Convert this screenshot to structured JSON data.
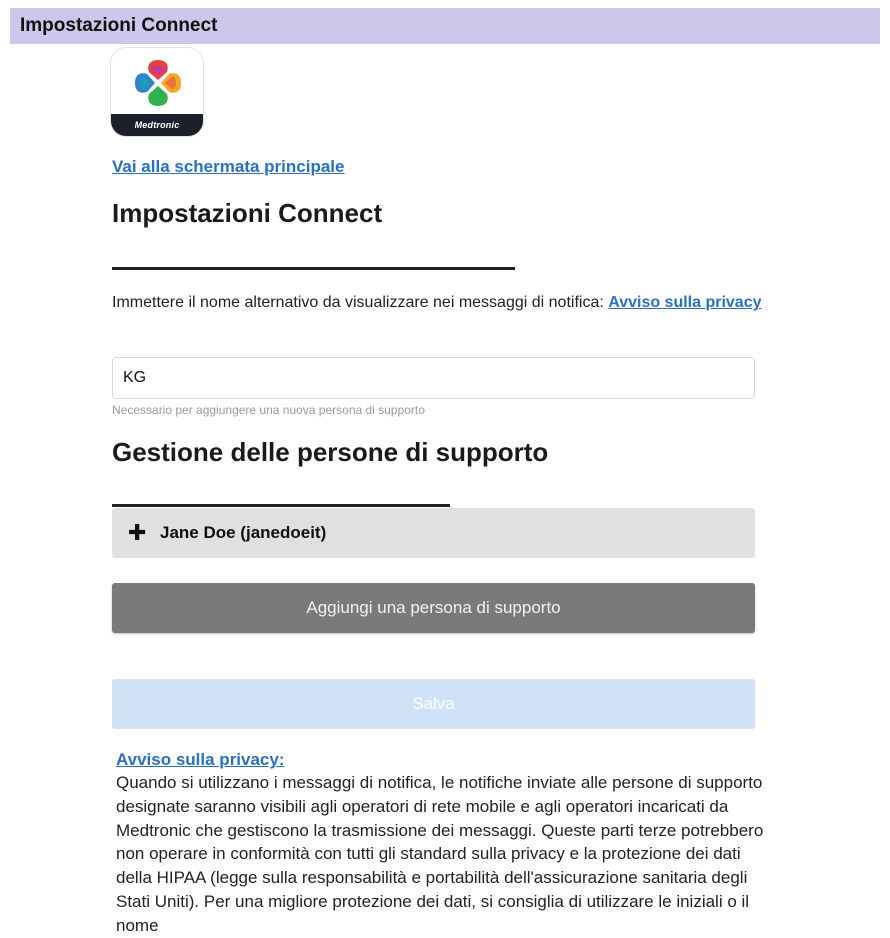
{
  "window": {
    "title": "Impostazioni Connect"
  },
  "brand": {
    "logo_text": "Medtronic"
  },
  "nav": {
    "home_link": "Vai alla schermata principale"
  },
  "settings": {
    "heading": "Impostazioni Connect",
    "instruction": "Immettere il nome alternativo da visualizzare nei messaggi di notifica:",
    "privacy_link": "Avviso sulla privacy",
    "name_value": "KG",
    "name_hint": "Necessario per aggiungere una nuova persona di supporto"
  },
  "support": {
    "heading": "Gestione delle persone di supporto",
    "people": [
      {
        "label": "Jane Doe (janedoeit)"
      }
    ],
    "add_button": "Aggiungi una persona di supporto"
  },
  "actions": {
    "save_button": "Salva"
  },
  "privacy": {
    "title": "Avviso sulla privacy:",
    "body": "Quando si utilizzano i messaggi di notifica, le notifiche inviate alle persone di supporto designate saranno visibili agli operatori di rete mobile e agli operatori incaricati da Medtronic che gestiscono la trasmissione dei messaggi. Queste parti terze potrebbero non operare in conformità con tutti gli standard sulla privacy e la protezione dei dati della HIPAA (legge sulla responsabilità e portabilità dell'assicurazione sanitaria degli Stati Uniti). Per una migliore protezione dei dati, si consiglia di utilizzare le iniziali o il nome"
  },
  "colors": {
    "titlebar_bg": "#cfc6ec",
    "link": "#2b6fc2",
    "add_button_bg": "#7a7a7a",
    "save_button_bg": "#cfe2f8",
    "person_row_bg": "#e0e0e0"
  },
  "icons": {
    "expand": "plus-icon",
    "logo": "medtronic-cross-icon"
  }
}
